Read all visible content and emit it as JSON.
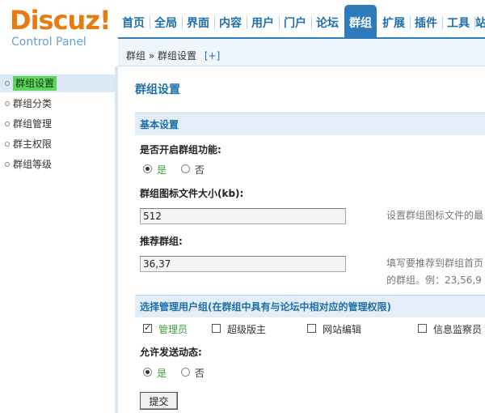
{
  "logo": {
    "main": "Discuz!",
    "sub": "Control Panel"
  },
  "nav": {
    "items": [
      "首页",
      "全局",
      "界面",
      "内容",
      "用户",
      "门户",
      "论坛",
      "群组",
      "扩展",
      "插件",
      "工具",
      "站"
    ],
    "active": "群组"
  },
  "breadcrumb": {
    "parent": "群组",
    "sep": "»",
    "current": "群组设置",
    "add": "[+]"
  },
  "sidebar": {
    "items": [
      {
        "label": "群组设置"
      },
      {
        "label": "群组分类"
      },
      {
        "label": "群组管理"
      },
      {
        "label": "群主权限"
      },
      {
        "label": "群组等级"
      }
    ],
    "active_index": 0
  },
  "main": {
    "title": "群组设置",
    "basic_section": "基本设置",
    "enable_group": {
      "label": "是否开启群组功能:",
      "yes": "是",
      "no": "否",
      "value": "是"
    },
    "icon_size": {
      "label": "群组图标文件大小(kb):",
      "value": "512",
      "hint": "设置群组图标文件的最"
    },
    "recommend": {
      "label": "推荐群组:",
      "value": "36,37",
      "hint_line1": "填写要推荐到群组首页",
      "hint_line2": "的群组。例：23,56,9"
    },
    "admin_section": "选择管理用户组(在群组中具有与论坛中相对应的管理权限)",
    "admin_groups": [
      {
        "label": "管理员",
        "checked": true
      },
      {
        "label": "超级版主",
        "checked": false
      },
      {
        "label": "网站编辑",
        "checked": false
      },
      {
        "label": "信息监察员",
        "checked": false
      }
    ],
    "allow_feed": {
      "label": "允许发送动态:",
      "yes": "是",
      "no": "否",
      "value": "是"
    },
    "submit_label": "提交"
  }
}
